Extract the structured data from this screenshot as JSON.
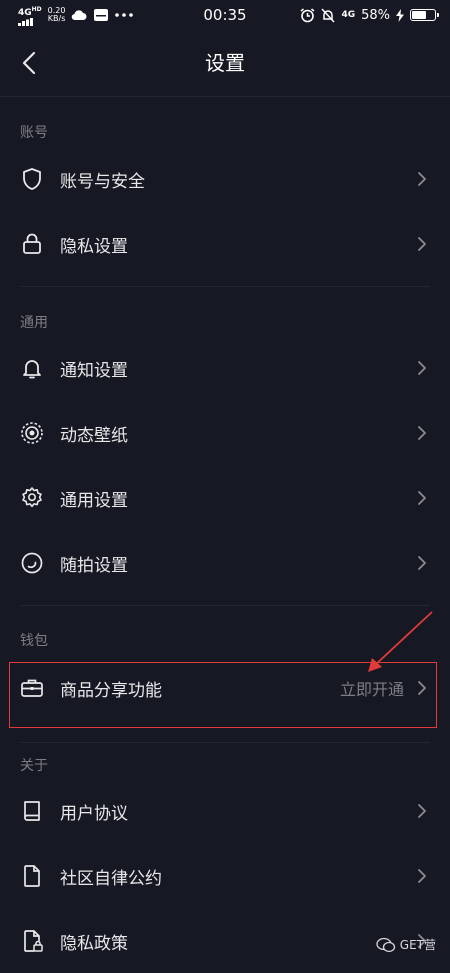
{
  "status_bar": {
    "network_type": "4G",
    "network_hd": "HD",
    "speed_value": "0.20",
    "speed_unit": "KB/s",
    "time": "00:35",
    "network_right": "4G",
    "battery_percent": "58%",
    "battery_level": 0.58
  },
  "header": {
    "title": "设置"
  },
  "sections": [
    {
      "title": "账号",
      "items": [
        {
          "label": "账号与安全",
          "icon": "shield-icon"
        },
        {
          "label": "隐私设置",
          "icon": "lock-icon"
        }
      ]
    },
    {
      "title": "通用",
      "items": [
        {
          "label": "通知设置",
          "icon": "bell-icon"
        },
        {
          "label": "动态壁纸",
          "icon": "wallpaper-icon"
        },
        {
          "label": "通用设置",
          "icon": "gear-icon"
        },
        {
          "label": "随拍设置",
          "icon": "moment-icon"
        }
      ]
    },
    {
      "title": "钱包",
      "items": [
        {
          "label": "商品分享功能",
          "icon": "briefcase-icon",
          "value": "立即开通"
        }
      ]
    },
    {
      "title": "关于",
      "items": [
        {
          "label": "用户协议",
          "icon": "book-icon"
        },
        {
          "label": "社区自律公约",
          "icon": "document-icon"
        },
        {
          "label": "隐私政策",
          "icon": "privacy-document-icon"
        }
      ]
    }
  ],
  "watermark": {
    "text": "GET营"
  },
  "colors": {
    "background": "#161823",
    "text": "#e8e8ea",
    "muted": "#7d7e84",
    "highlight": "#e03a3a"
  }
}
